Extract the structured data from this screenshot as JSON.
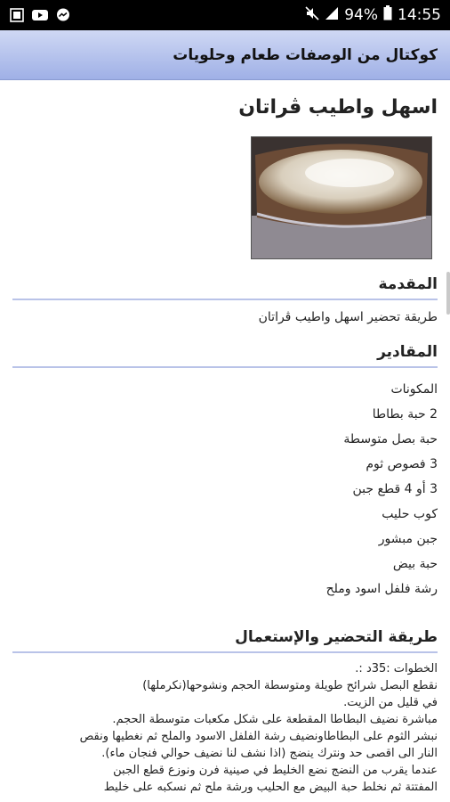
{
  "status": {
    "battery": "94%",
    "time": "14:55",
    "icons": [
      "gallery-icon",
      "youtube-icon",
      "messenger-icon",
      "mute-icon",
      "signal-icon",
      "battery-icon"
    ]
  },
  "app": {
    "title": "كوكتال من الوصفات طعام وحلويات"
  },
  "recipe": {
    "title": "اسهل واطيب ڤراتان",
    "intro_heading": "المقدمة",
    "intro_text": "طريقة تحضير اسهل واطيب ڤراتان",
    "ingredients_heading": "المقادير",
    "ingredients": [
      "المكونات",
      "2 حبة بطاطا",
      "حبة بصل متوسطة",
      "3 فصوص ثوم",
      "3 أو 4 قطع جبن",
      "كوب حليب",
      "جبن مبشور",
      "حبة بيض",
      "رشة فلفل اسود وملح"
    ],
    "method_heading": "طريقة التحضير والإستعمال",
    "method_lines": [
      "الخطوات :35د :.",
      "نقطع البصل شرائح طويلة ومتوسطة الحجم ونشوحها(نكرملها)",
      "في قليل من الزيت.",
      "مباشرة نضيف البطاطا المقطعة على شكل مكعبات متوسطة الحجم.",
      "نبشر الثوم على البطاطاونضيف رشة الفلفل الاسود والملح ثم نغطيها ونقص",
      "النار الى اقصى حد ونترك ينضج (اذا نشف لنا نضيف حوالي فنجان ماء).",
      "عندما يقرب من النضج نضع الخليط في صينية فرن ونوزع قطع الجبن",
      "المفتتة ثم نخلط حبة البيض مع الحليب ورشة ملح ثم نسكبه على خليط"
    ]
  }
}
